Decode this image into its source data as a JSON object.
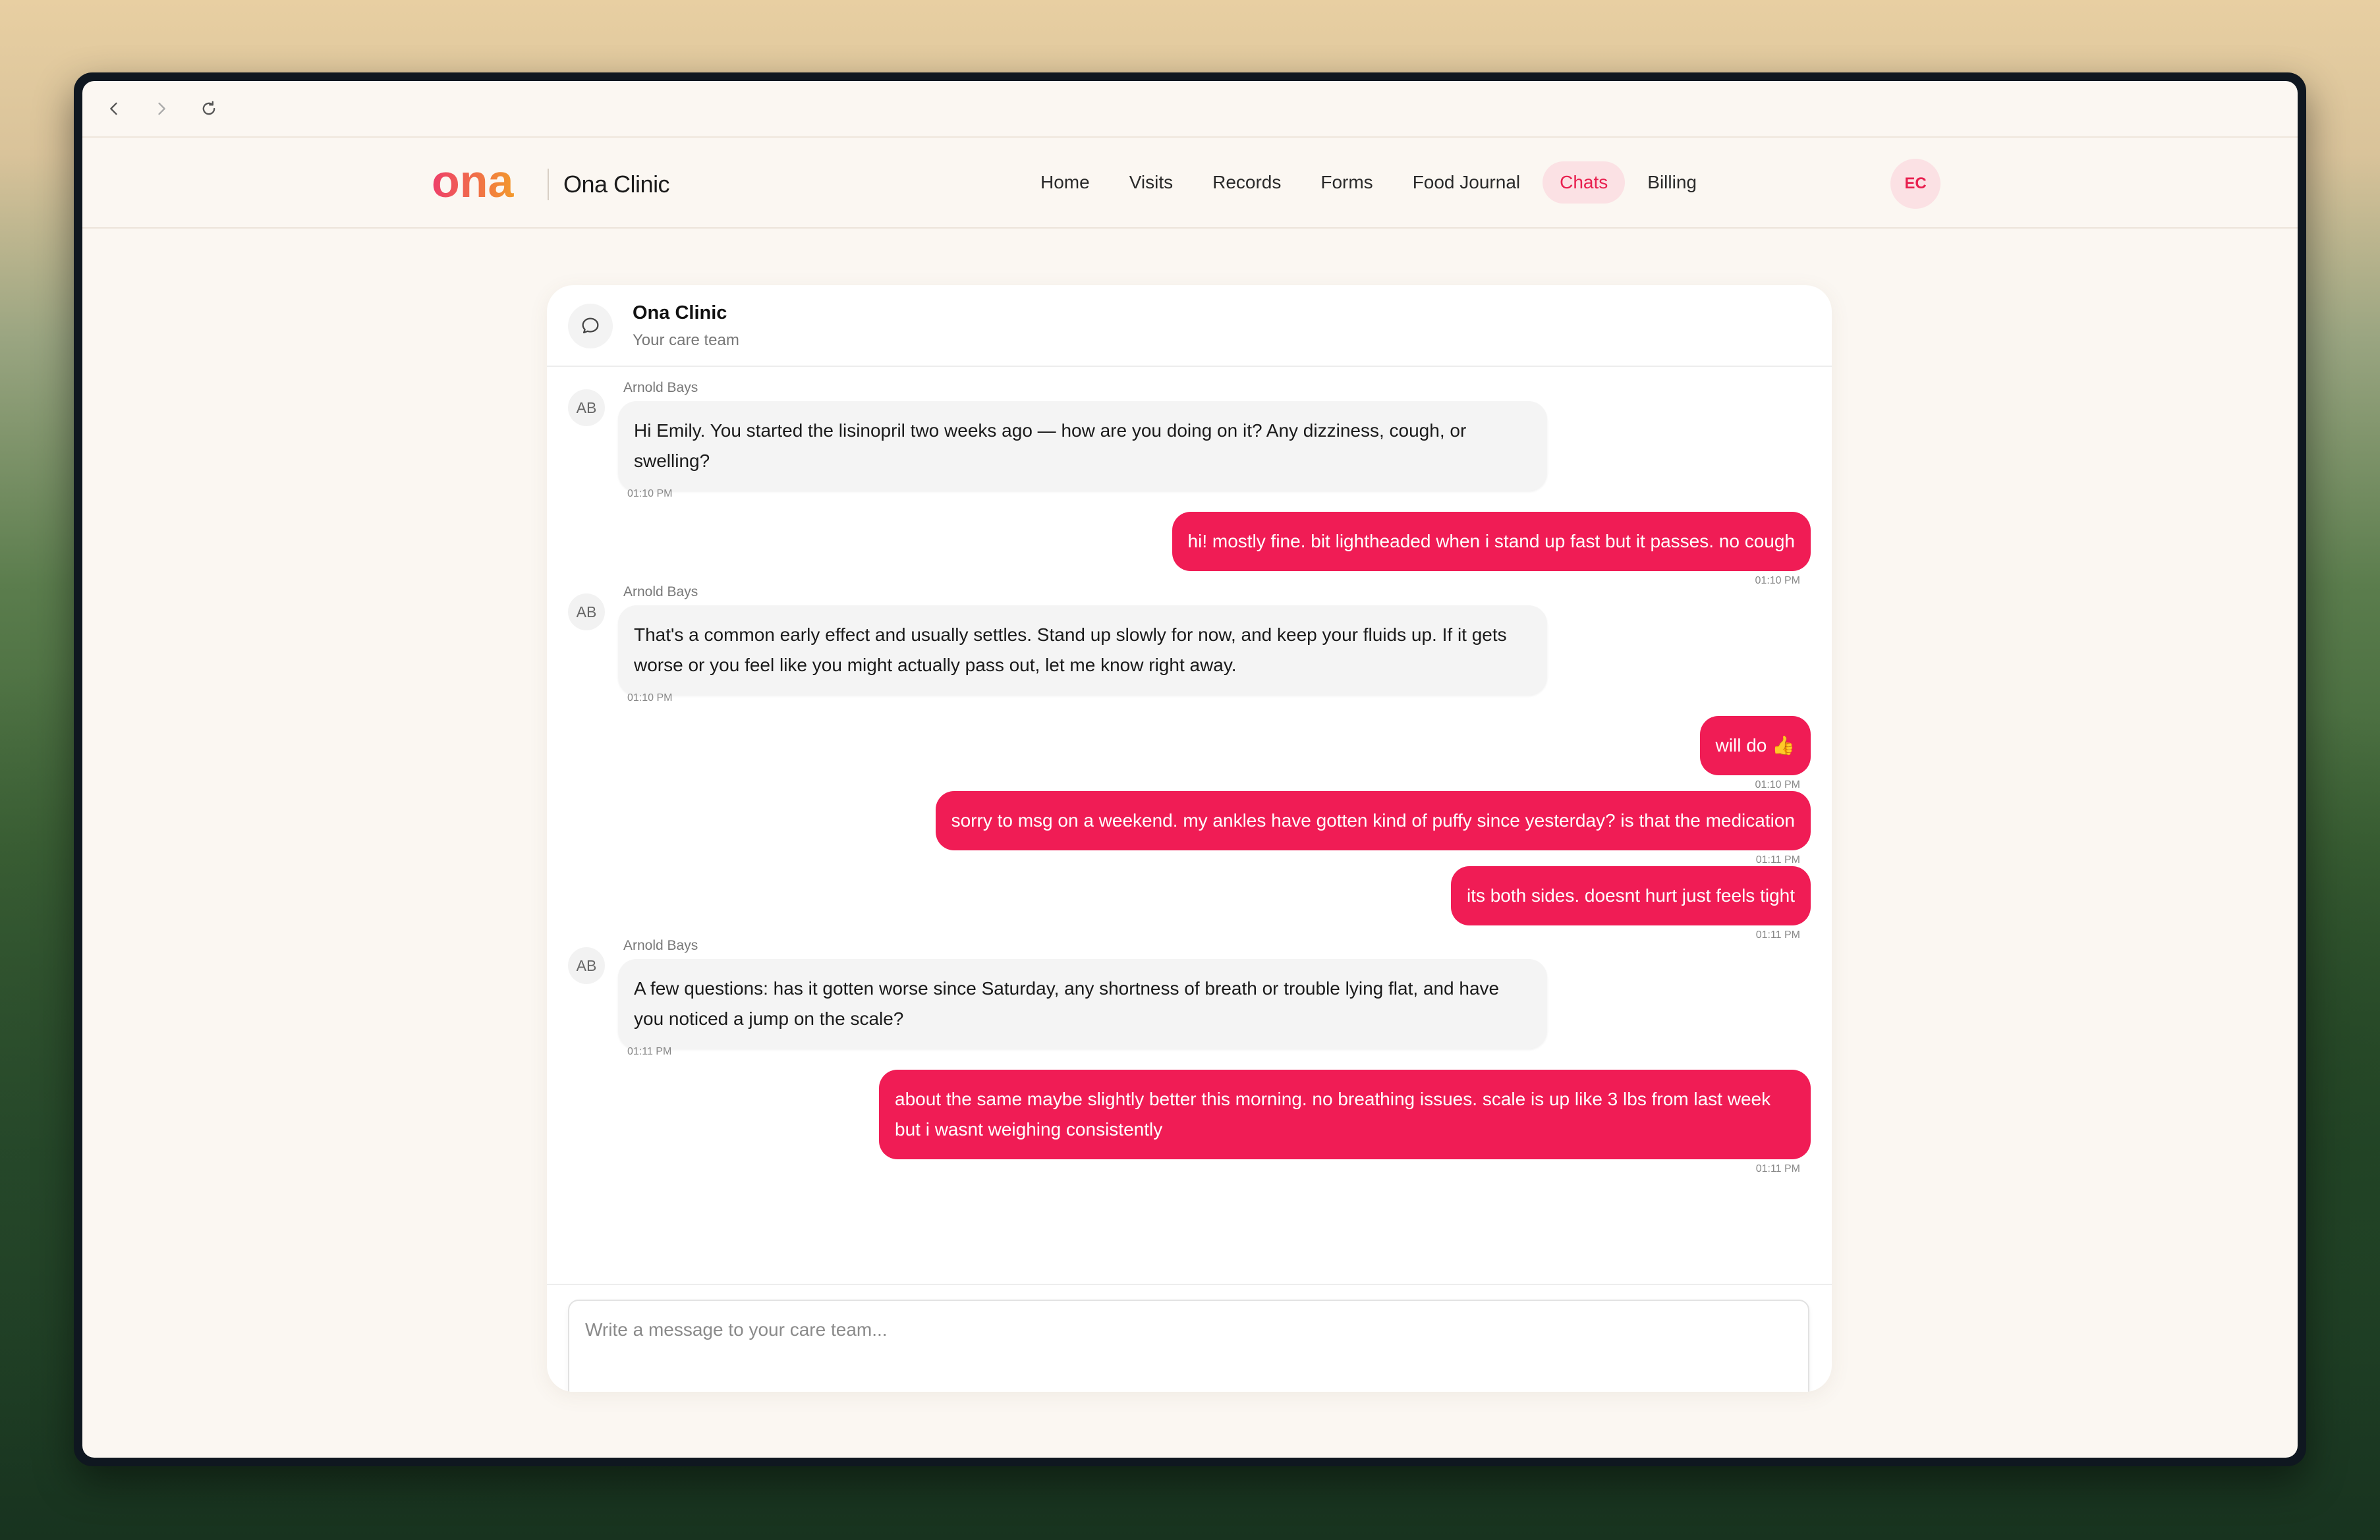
{
  "browser": {
    "back_icon": "chevron-left-icon",
    "forward_icon": "chevron-right-icon",
    "reload_icon": "reload-icon"
  },
  "header": {
    "logo_text": "ona",
    "brand": "Ona Clinic",
    "nav": [
      {
        "label": "Home",
        "active": false
      },
      {
        "label": "Visits",
        "active": false
      },
      {
        "label": "Records",
        "active": false
      },
      {
        "label": "Forms",
        "active": false
      },
      {
        "label": "Food Journal",
        "active": false
      },
      {
        "label": "Chats",
        "active": true
      },
      {
        "label": "Billing",
        "active": false
      }
    ],
    "user_initials": "EC"
  },
  "chat": {
    "title": "Ona Clinic",
    "subtitle": "Your care team",
    "messages": [
      {
        "direction": "in",
        "sender_initials": "AB",
        "sender": "Arnold Bays",
        "text": "Hi Emily. You started the lisinopril two weeks ago — how are you doing on it? Any dizziness, cough, or swelling?",
        "time": "01:10 PM"
      },
      {
        "direction": "out",
        "text": "hi! mostly fine. bit lightheaded when i stand up fast but it passes. no cough",
        "time": "01:10 PM"
      },
      {
        "direction": "in",
        "sender_initials": "AB",
        "sender": "Arnold Bays",
        "text": "That's a common early effect and usually settles. Stand up slowly for now, and keep your fluids up. If it gets worse or you feel like you might actually pass out, let me know right away.",
        "time": "01:10 PM"
      },
      {
        "direction": "out",
        "text": "will do 👍",
        "time": "01:10 PM"
      },
      {
        "direction": "out",
        "text": "sorry to msg on a weekend. my ankles have gotten kind of puffy since yesterday? is that the medication",
        "time": "01:11 PM"
      },
      {
        "direction": "out",
        "text": "its both sides. doesnt hurt just feels tight",
        "time": "01:11 PM"
      },
      {
        "direction": "in",
        "sender_initials": "AB",
        "sender": "Arnold Bays",
        "text": "A few questions: has it gotten worse since Saturday, any shortness of breath or trouble lying flat, and have you noticed a jump on the scale?",
        "time": "01:11 PM"
      },
      {
        "direction": "out",
        "text": "about the same maybe slightly better this morning. no breathing issues. scale is up like 3 lbs from last week but i wasnt weighing consistently",
        "time": "01:11 PM"
      }
    ],
    "composer": {
      "placeholder": "Write a message to your care team...",
      "value": "",
      "send_icon": "enter-icon"
    }
  },
  "colors": {
    "accent": "#f01c55",
    "logo_pink": "#ee3e6a",
    "logo_orange": "#f39a2c",
    "nav_active_bg": "#fbe1e4"
  }
}
